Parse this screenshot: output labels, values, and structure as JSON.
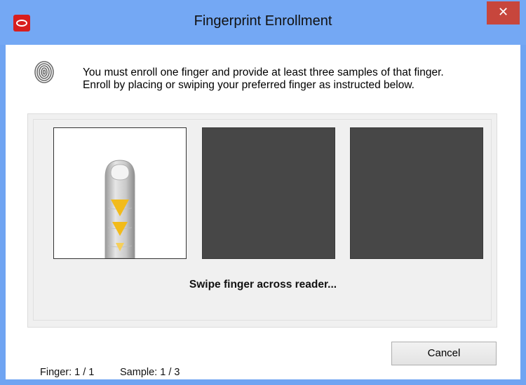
{
  "window": {
    "title": "Fingerprint Enrollment",
    "close_glyph": "✕"
  },
  "icons": {
    "app": "oracle-app-icon",
    "instruction": "fingerprint-icon",
    "close": "close-icon"
  },
  "instructions": {
    "line1": "You must enroll one finger and provide at least three samples of that finger.",
    "line2": "Enroll by placing or swiping your preferred finger as instructed below."
  },
  "samples": {
    "count": 3,
    "captured": 0
  },
  "status_text": "Swipe finger across reader...",
  "footer": {
    "finger_label": "Finger: 1 / 1",
    "sample_label": "Sample: 1 / 3"
  },
  "buttons": {
    "cancel": "Cancel"
  },
  "colors": {
    "titlebar": "#74a8f4",
    "close_button": "#c7463c",
    "app_icon": "#d81e1e",
    "empty_sample": "#474747",
    "swipe_arrows": "#f2bb1a"
  }
}
